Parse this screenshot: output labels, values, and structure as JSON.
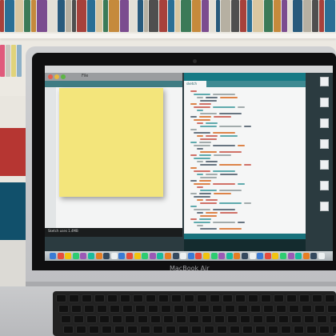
{
  "laptop": {
    "brand_label": "MacBook Air"
  },
  "screen": {
    "left_window": {
      "title": "File",
      "console_text": "Sketch uses 1.4MB"
    },
    "right_window": {
      "tab_label": "sketch"
    },
    "desktop_icons": [
      "",
      "",
      "",
      "",
      "",
      "",
      ""
    ],
    "dock_icon_count": 36
  },
  "scene": {
    "sticky_note_color": "#f3e57b",
    "accent_teal": "#18727c"
  }
}
